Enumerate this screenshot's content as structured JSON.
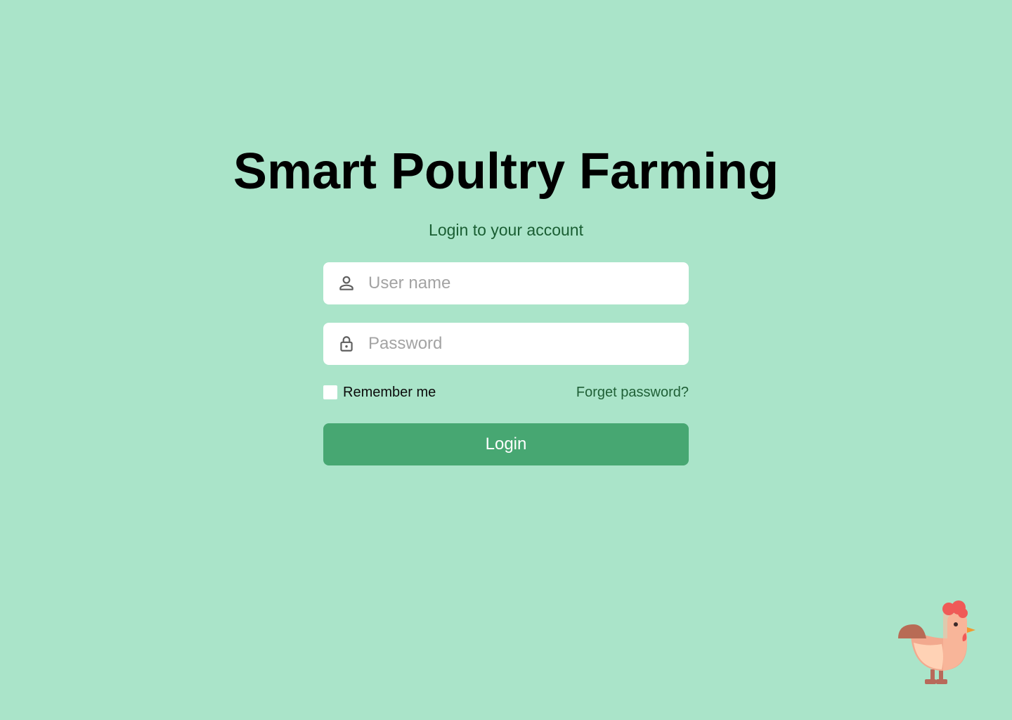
{
  "header": {
    "title": "Smart Poultry Farming",
    "subtitle": "Login to your account"
  },
  "form": {
    "username": {
      "placeholder": "User name",
      "value": "",
      "icon": "user-icon"
    },
    "password": {
      "placeholder": "Password",
      "value": "",
      "icon": "lock-icon"
    },
    "remember_label": "Remember me",
    "remember_checked": false,
    "forgot_label": "Forget password?",
    "login_label": "Login"
  },
  "decoration": {
    "mascot": "rooster-illustration"
  },
  "colors": {
    "background": "#aae4c9",
    "accent": "#47a772",
    "link": "#1f5f36",
    "subtitle": "#1a5e33"
  }
}
